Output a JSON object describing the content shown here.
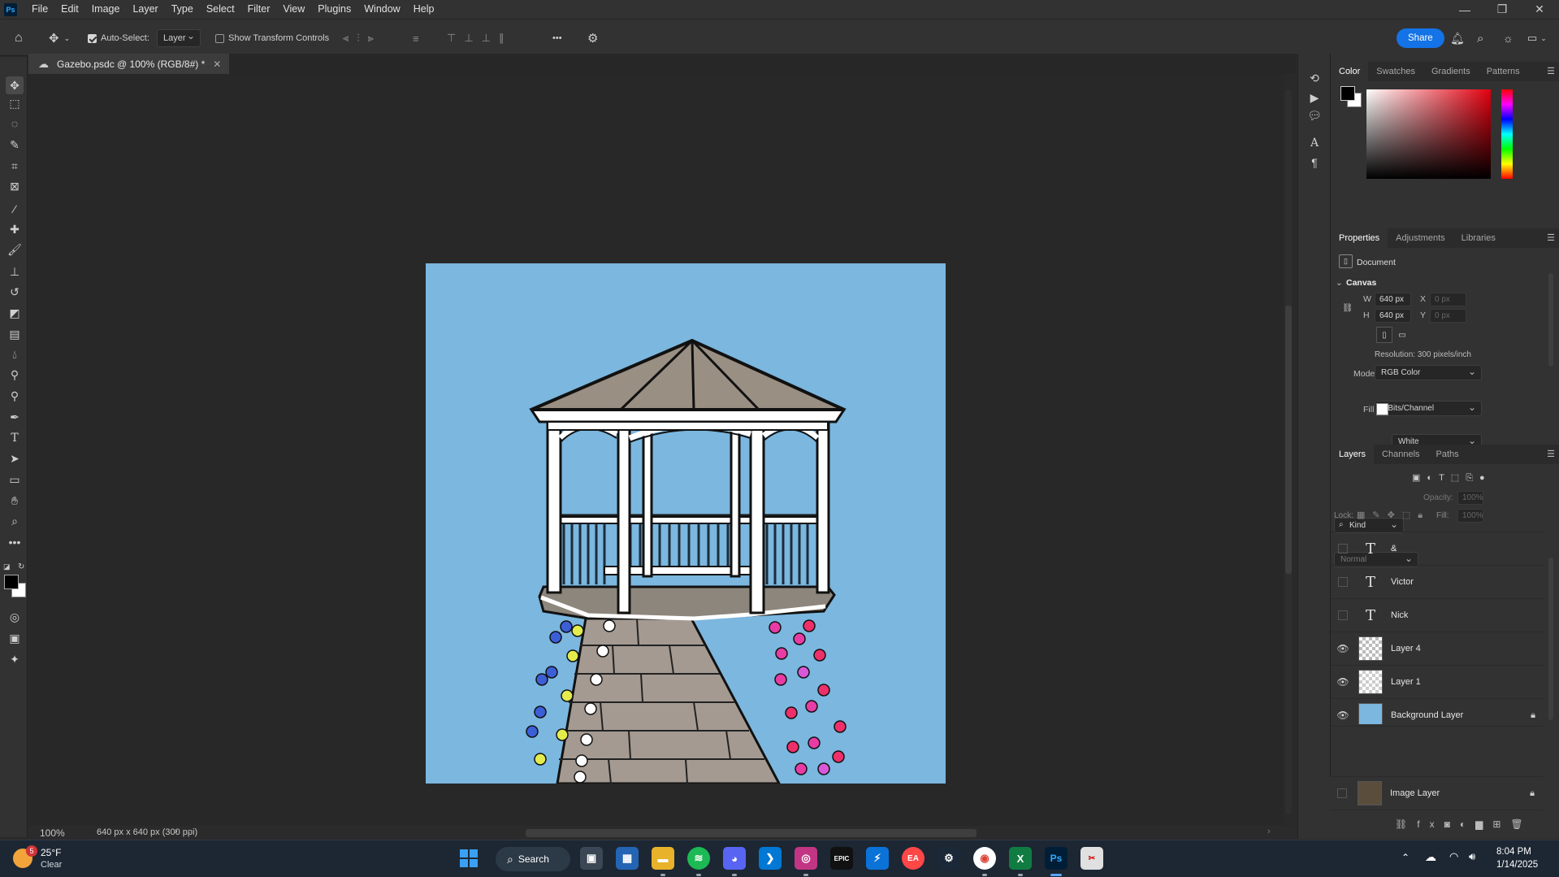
{
  "app": {
    "logo": "Ps",
    "name": "Adobe Photoshop"
  },
  "menu": [
    "File",
    "Edit",
    "Image",
    "Layer",
    "Type",
    "Select",
    "Filter",
    "View",
    "Plugins",
    "Window",
    "Help"
  ],
  "window_controls": {
    "minimize": "—",
    "restore": "❐",
    "close": "✕"
  },
  "options_bar": {
    "auto_select_label": "Auto-Select:",
    "auto_select_checked": true,
    "auto_select_target": "Layer",
    "show_transform_label": "Show Transform Controls",
    "more": "•••",
    "share_label": "Share"
  },
  "document": {
    "tab_title": "Gazebo.psdc @ 100% (RGB/8#) *",
    "zoom": "100%",
    "status_info": "640 px x 640 px (300 ppi)"
  },
  "color_panel": {
    "tabs": [
      "Color",
      "Swatches",
      "Gradients",
      "Patterns"
    ],
    "active_tab": "Color",
    "foreground": "#000000",
    "background": "#ffffff"
  },
  "properties_panel": {
    "tabs": [
      "Properties",
      "Adjustments",
      "Libraries"
    ],
    "active_tab": "Properties",
    "section_label": "Document",
    "canvas_label": "Canvas",
    "w_label": "W",
    "w_value": "640 px",
    "h_label": "H",
    "h_value": "640 px",
    "x_label": "X",
    "x_value": "0 px",
    "y_label": "Y",
    "y_value": "0 px",
    "resolution": "Resolution: 300 pixels/inch",
    "mode_label": "Mode",
    "mode_value": "RGB Color",
    "bits_value": "8 Bits/Channel",
    "fill_label": "Fill",
    "fill_value": "White"
  },
  "layers_panel": {
    "tabs": [
      "Layers",
      "Channels",
      "Paths"
    ],
    "active_tab": "Layers",
    "filter_kind": "Kind",
    "blend_mode": "Normal",
    "opacity_label": "Opacity:",
    "opacity_value": "100%",
    "lock_label": "Lock:",
    "fill_label": "Fill:",
    "fill_value": "100%",
    "layers": [
      {
        "name": "&",
        "kind": "type",
        "visible": false,
        "locked": false
      },
      {
        "name": "Victor",
        "kind": "type",
        "visible": false,
        "locked": false
      },
      {
        "name": "Nick",
        "kind": "type",
        "visible": false,
        "locked": false
      },
      {
        "name": "Layer 4",
        "kind": "pixel",
        "visible": true,
        "locked": false
      },
      {
        "name": "Layer 1",
        "kind": "pixel",
        "visible": true,
        "locked": false
      },
      {
        "name": "Background Layer",
        "kind": "pixel",
        "visible": true,
        "locked": true
      },
      {
        "name": "Image Layer",
        "kind": "pixel",
        "visible": false,
        "locked": true
      }
    ]
  },
  "taskbar": {
    "weather_temp": "25°F",
    "weather_desc": "Clear",
    "weather_badge": "5",
    "search_label": "Search",
    "time": "8:04 PM",
    "date": "1/14/2025"
  },
  "icons": {
    "move": "move-icon",
    "marquee": "marquee-icon",
    "lasso": "lasso-icon",
    "type_layer_glyph": "T"
  }
}
